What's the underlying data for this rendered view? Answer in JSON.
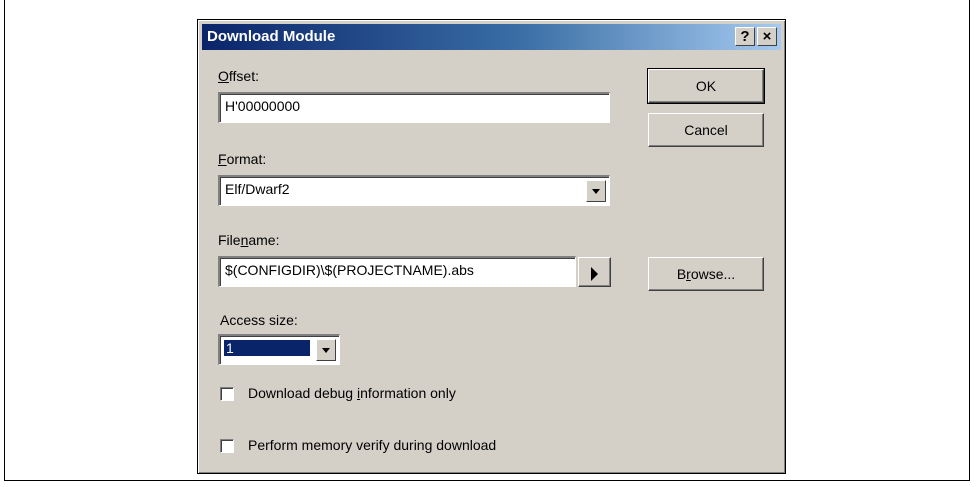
{
  "dialog": {
    "title": "Download Module",
    "help_button": "?",
    "close_button": "×"
  },
  "offset": {
    "label_accel": "O",
    "label_rest": "ffset:",
    "value": "H'00000000"
  },
  "format": {
    "label_accel": "F",
    "label_rest": "ormat:",
    "value": "Elf/Dwarf2"
  },
  "filename": {
    "label_pre": "File",
    "label_accel": "n",
    "label_post": "ame:",
    "value": "$(CONFIGDIR)\\$(PROJECTNAME).abs"
  },
  "access_size": {
    "label": "Access size:",
    "value": "1"
  },
  "checkboxes": {
    "debug_pre": "Download debug ",
    "debug_accel": "i",
    "debug_post": "nformation only",
    "debug_checked": false,
    "verify_label": "Perform memory verify during download",
    "verify_checked": false
  },
  "buttons": {
    "ok": "OK",
    "cancel": "Cancel",
    "browse_pre": "B",
    "browse_accel": "r",
    "browse_post": "owse..."
  }
}
